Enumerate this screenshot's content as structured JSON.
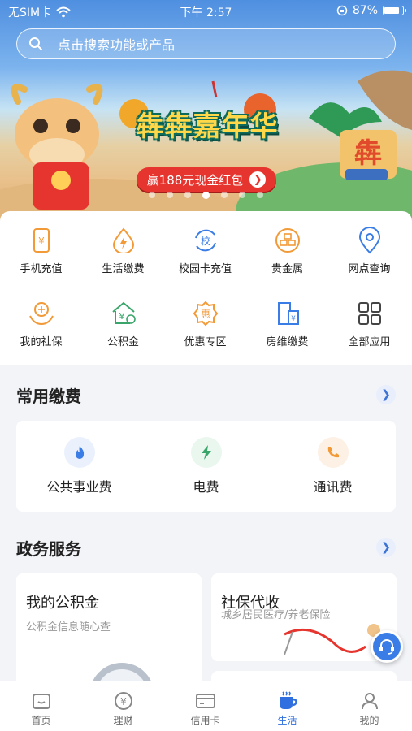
{
  "status_bar": {
    "carrier": "无SIM卡",
    "time": "下午 2:57",
    "battery": "87%"
  },
  "search": {
    "placeholder": "点击搜索功能或产品"
  },
  "banner": {
    "title": "犇犇嘉年华",
    "button": "赢188元现金红包",
    "dots": 7,
    "active_dot": 3
  },
  "quick_menu": [
    {
      "label": "手机充值",
      "icon": "phone-recharge-icon"
    },
    {
      "label": "生活缴费",
      "icon": "lightning-drop-icon"
    },
    {
      "label": "校园卡充值",
      "icon": "campus-card-icon"
    },
    {
      "label": "贵金属",
      "icon": "gold-bars-icon"
    },
    {
      "label": "网点查询",
      "icon": "location-pin-icon"
    },
    {
      "label": "我的社保",
      "icon": "social-security-icon"
    },
    {
      "label": "公积金",
      "icon": "housing-fund-icon"
    },
    {
      "label": "优惠专区",
      "icon": "discount-icon"
    },
    {
      "label": "房维缴费",
      "icon": "building-repair-icon"
    },
    {
      "label": "全部应用",
      "icon": "all-apps-grid-icon"
    }
  ],
  "common_fees": {
    "title": "常用缴费",
    "items": [
      {
        "label": "公共事业费",
        "icon": "flame-icon"
      },
      {
        "label": "电费",
        "icon": "lightning-icon"
      },
      {
        "label": "通讯费",
        "icon": "phone-call-icon"
      }
    ]
  },
  "gov_services": {
    "title": "政务服务",
    "card1": {
      "title": "我的公积金",
      "subtitle": "公积金信息随心查"
    },
    "card2": {
      "title": "社保代收",
      "subtitle": "城乡居民医疗/养老保险"
    }
  },
  "tabbar": {
    "active": 3,
    "items": [
      {
        "label": "首页",
        "icon": "home-icon"
      },
      {
        "label": "理财",
        "icon": "yuan-coin-icon"
      },
      {
        "label": "信用卡",
        "icon": "credit-card-icon"
      },
      {
        "label": "生活",
        "icon": "coffee-cup-icon"
      },
      {
        "label": "我的",
        "icon": "user-icon"
      }
    ]
  },
  "colors": {
    "accent": "#2f6fe0",
    "banner_button": "#e6352e",
    "icon_orange": "#f29a38",
    "icon_blue": "#3b7de6"
  }
}
